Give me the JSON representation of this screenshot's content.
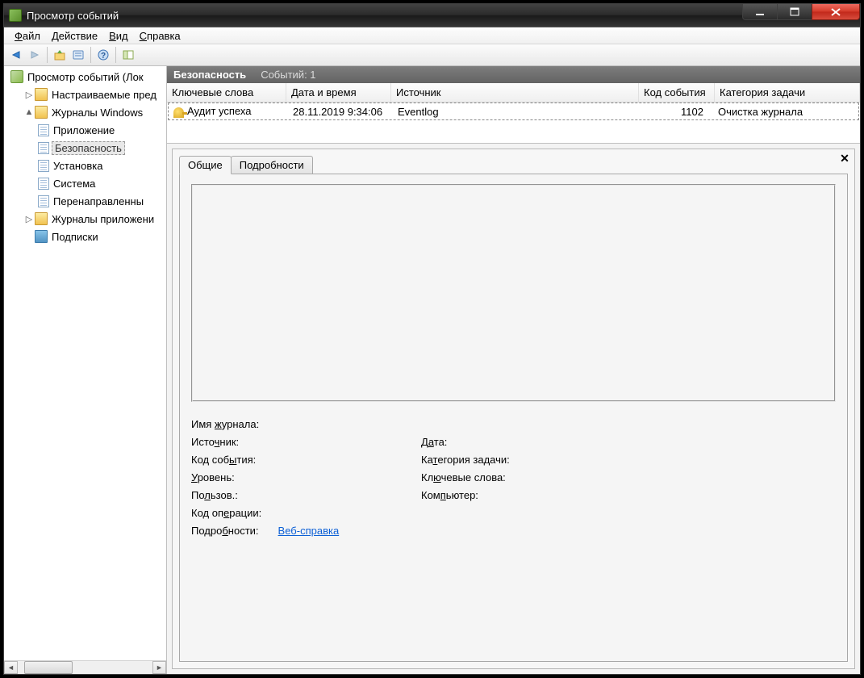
{
  "title": "Просмотр событий",
  "menu": {
    "file": "Файл",
    "action": "Действие",
    "view": "Вид",
    "help": "Справка"
  },
  "tree": {
    "root": "Просмотр событий (Лок",
    "custom": "Настраиваемые пред",
    "windows": "Журналы Windows",
    "app": "Приложение",
    "security": "Безопасность",
    "setup": "Установка",
    "system": "Система",
    "forwarded": "Перенаправленны",
    "appsvc": "Журналы приложени",
    "subs": "Подписки"
  },
  "log": {
    "name": "Безопасность",
    "count_label": "Событий: 1"
  },
  "columns": {
    "keywords": "Ключевые слова",
    "datetime": "Дата и время",
    "source": "Источник",
    "eventid": "Код события",
    "category": "Категория задачи"
  },
  "row": {
    "keywords": "Аудит успеха",
    "datetime": "28.11.2019 9:34:06",
    "source": "Eventlog",
    "eventid": "1102",
    "category": "Очистка журнала"
  },
  "tabs": {
    "general": "Общие",
    "details": "Подробности"
  },
  "fields": {
    "logname": "Имя журнала:",
    "source": "Источник:",
    "date": "Дата:",
    "eventid": "Код события:",
    "category": "Категория задачи:",
    "level": "Уровень:",
    "keywords": "Ключевые слова:",
    "user": "Пользов.:",
    "computer": "Компьютер:",
    "opcode": "Код операции:",
    "moreinfo": "Подробности:",
    "weblink": "Веб-справка "
  }
}
